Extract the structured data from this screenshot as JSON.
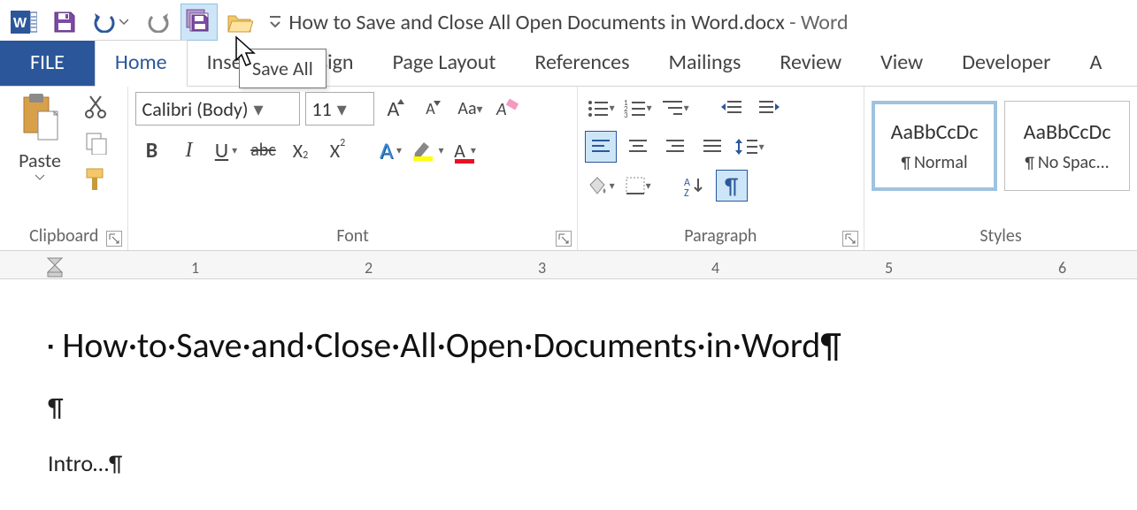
{
  "title": {
    "document_name": "How to Save and Close All Open Documents in Word.docx",
    "app_name": "Word"
  },
  "qat": {
    "word_icon": "word-app-icon",
    "save": "save-icon",
    "undo": "undo-icon",
    "redo": "redo-icon",
    "save_all": "save-all-icon",
    "open": "open-folder-icon",
    "customize": "customize-qat-icon"
  },
  "tooltip": {
    "save_all": "Save All"
  },
  "tabs": {
    "file": "FILE",
    "items": [
      "Home",
      "Insert",
      "Design",
      "Page Layout",
      "References",
      "Mailings",
      "Review",
      "View",
      "Developer",
      "A"
    ]
  },
  "ribbon": {
    "clipboard": {
      "label": "Clipboard",
      "paste": "Paste"
    },
    "font": {
      "label": "Font",
      "family": "Calibri (Body)",
      "size": "11"
    },
    "paragraph": {
      "label": "Paragraph"
    },
    "styles": {
      "label": "Styles",
      "items": [
        {
          "preview": "AaBbCcDc",
          "name": "Normal",
          "selected": true,
          "show_pilcrow": true
        },
        {
          "preview": "AaBbCcDc",
          "name": "No Spac...",
          "selected": false,
          "show_pilcrow": true
        }
      ]
    }
  },
  "ruler": {
    "numbers": [
      "1",
      "2",
      "3",
      "4",
      "5",
      "6"
    ]
  },
  "document": {
    "heading": "How·to·Save·and·Close·All·Open·Documents·in·Word¶",
    "blank_para": "¶",
    "intro": "Intro…¶"
  }
}
